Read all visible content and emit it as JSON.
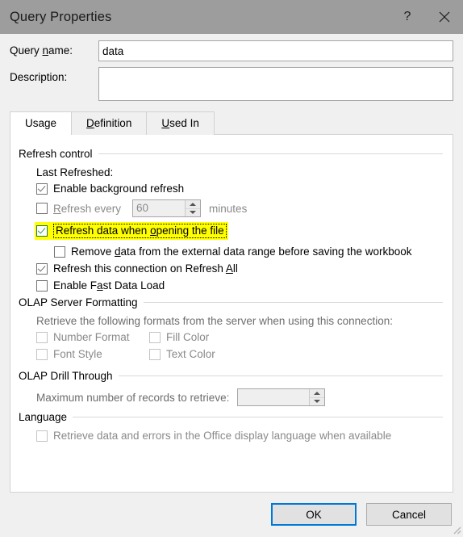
{
  "window": {
    "title": "Query Properties",
    "help_icon": "question-mark-icon",
    "close_icon": "close-icon"
  },
  "header": {
    "query_name_label_pre": "Query ",
    "query_name_label_accel": "n",
    "query_name_label_post": "ame:",
    "query_name_value": "data",
    "query_name_placeholder": "",
    "description_label": "Description:",
    "description_value": "",
    "description_placeholder": ""
  },
  "tabs": [
    {
      "label_pre": "Usa",
      "accel": "g",
      "label_post": "e",
      "active": true,
      "name": "usage"
    },
    {
      "label_pre": "",
      "accel": "D",
      "label_post": "efinition",
      "active": false,
      "name": "definition"
    },
    {
      "label_pre": "",
      "accel": "U",
      "label_post": "sed In",
      "active": false,
      "name": "used-in"
    }
  ],
  "usage": {
    "refresh_control": {
      "group_label": "Refresh control",
      "last_refreshed_label": "Last Refreshed:",
      "enable_background_refresh": {
        "label": "Enable background refresh",
        "checked": true,
        "state": "checked"
      },
      "refresh_every": {
        "label_pre": "",
        "accel": "R",
        "label_post": "efresh every",
        "checked": false,
        "interval_value": "60",
        "unit_label": "minutes",
        "disabled": true
      },
      "refresh_on_open": {
        "label_pre": "Refresh data when ",
        "accel": "o",
        "label_post": "pening the file",
        "checked": true,
        "highlighted": true,
        "focused": true
      },
      "remove_data": {
        "label_pre": "Remove ",
        "accel": "d",
        "label_post": "ata from the external data range before saving the workbook",
        "checked": false
      },
      "refresh_all": {
        "label_pre": "Refresh this connection on Refresh ",
        "accel": "A",
        "label_post": "ll",
        "checked": true
      },
      "fast_data_load": {
        "label_pre": "Enable F",
        "accel": "a",
        "label_post": "st Data Load",
        "checked": false
      }
    },
    "olap_server_formatting": {
      "group_label": "OLAP Server Formatting",
      "description": "Retrieve the following formats from the server when using this connection:",
      "options": [
        {
          "label": "Number Format",
          "checked": false,
          "disabled": true,
          "name": "number-format"
        },
        {
          "label": "Fill Color",
          "checked": false,
          "disabled": true,
          "name": "fill-color"
        },
        {
          "label": "Font Style",
          "checked": false,
          "disabled": true,
          "name": "font-style"
        },
        {
          "label": "Text Color",
          "checked": false,
          "disabled": true,
          "name": "text-color"
        }
      ]
    },
    "olap_drill_through": {
      "group_label": "OLAP Drill Through",
      "max_records_label": "Maximum number of records to retrieve:",
      "max_records_value": "",
      "disabled": true
    },
    "language": {
      "group_label": "Language",
      "retrieve_office_language": {
        "label": "Retrieve data and errors in the Office display language when available",
        "checked": false,
        "disabled": true
      }
    }
  },
  "footer": {
    "ok_label": "OK",
    "cancel_label": "Cancel"
  },
  "colors": {
    "titlebar": "#9d9d9d",
    "dialog_bg": "#f0f0f0",
    "panel_bg": "#ffffff",
    "highlight": "#ffff00",
    "accent_focus": "#0078d7",
    "green_check": "#2fa14f",
    "disabled_text": "#8a8a8a"
  }
}
